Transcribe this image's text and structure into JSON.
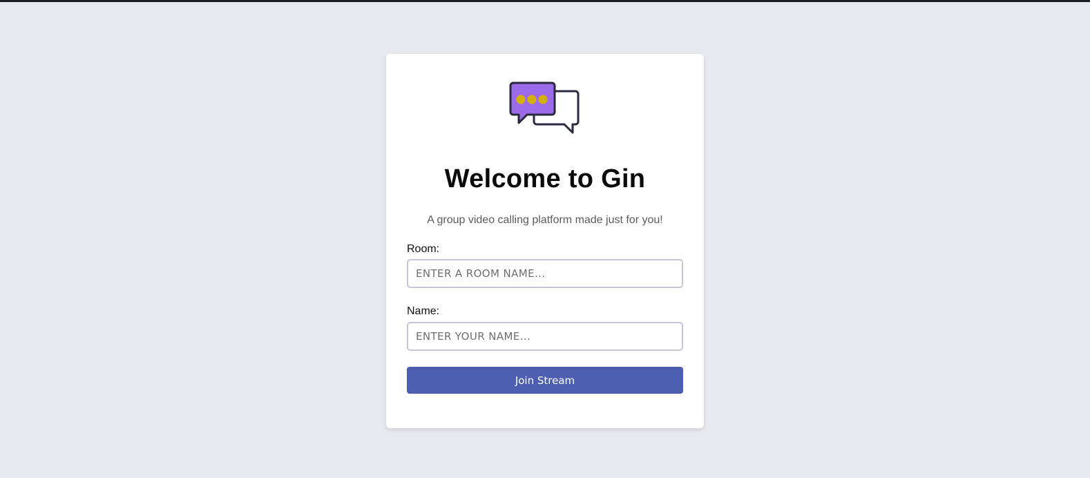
{
  "page": {
    "title": "Welcome to Gin",
    "subtitle": "A group video calling platform made just for you!"
  },
  "form": {
    "room_label": "Room:",
    "room_placeholder": "ENTER A ROOM NAME...",
    "room_value": "",
    "name_label": "Name:",
    "name_placeholder": "ENTER YOUR NAME...",
    "name_value": "",
    "submit_label": "Join Stream"
  },
  "colors": {
    "background": "#e8e9ee",
    "card": "#ffffff",
    "button": "#4d5db0",
    "logo_bubble": "#9b6bea",
    "logo_dots": "#d4b000",
    "logo_outline": "#2a2a3e"
  },
  "icons": {
    "logo": "chat-bubbles-icon"
  }
}
